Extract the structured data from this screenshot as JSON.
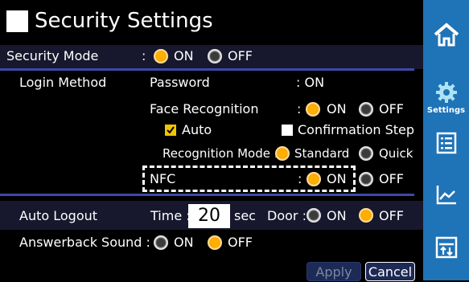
{
  "page": {
    "title": "Security Settings",
    "colors": {
      "background": "#000000",
      "sidebar": "#1f73b7",
      "separator": "#3d4aa8",
      "radio_on": "#ff9a00",
      "radio_off": "#6a6a6a",
      "checkbox_checked": "#f2c400",
      "nfc_highlight": "#ffffff"
    }
  },
  "security_mode": {
    "label": "Security Mode",
    "colon": ":",
    "on_label": "ON",
    "off_label": "OFF",
    "selected": "ON"
  },
  "login_method": {
    "label": "Login Method",
    "password": {
      "label": "Password",
      "value": ": ON"
    },
    "face_recognition": {
      "label": "Face Recognition",
      "colon": ":",
      "on_label": "ON",
      "off_label": "OFF",
      "selected": "ON",
      "auto": {
        "label": "Auto",
        "checked": true
      },
      "confirmation_step": {
        "label": "Confirmation Step",
        "checked": false
      },
      "recognition_mode": {
        "label": "Recognition Mode :",
        "standard_label": "Standard",
        "quick_label": "Quick",
        "selected": "Standard"
      }
    },
    "nfc": {
      "label": "NFC",
      "colon": ":",
      "on_label": "ON",
      "off_label": "OFF",
      "selected": "ON"
    }
  },
  "auto_logout": {
    "label": "Auto Logout",
    "time_label": "Time :",
    "time_value": "20",
    "time_unit": "sec",
    "door_label": "Door :",
    "on_label": "ON",
    "off_label": "OFF",
    "selected": "OFF"
  },
  "answerback_sound": {
    "label": "Answerback Sound :",
    "on_label": "ON",
    "off_label": "OFF",
    "selected": "OFF"
  },
  "buttons": {
    "apply": "Apply",
    "cancel": "Cancel"
  },
  "sidebar": {
    "items": [
      {
        "icon": "home-icon",
        "label": ""
      },
      {
        "icon": "gear-icon",
        "label": "Settings"
      },
      {
        "icon": "list-icon",
        "label": ""
      },
      {
        "icon": "chart-line-icon",
        "label": ""
      },
      {
        "icon": "transfer-icon",
        "label": ""
      }
    ]
  }
}
